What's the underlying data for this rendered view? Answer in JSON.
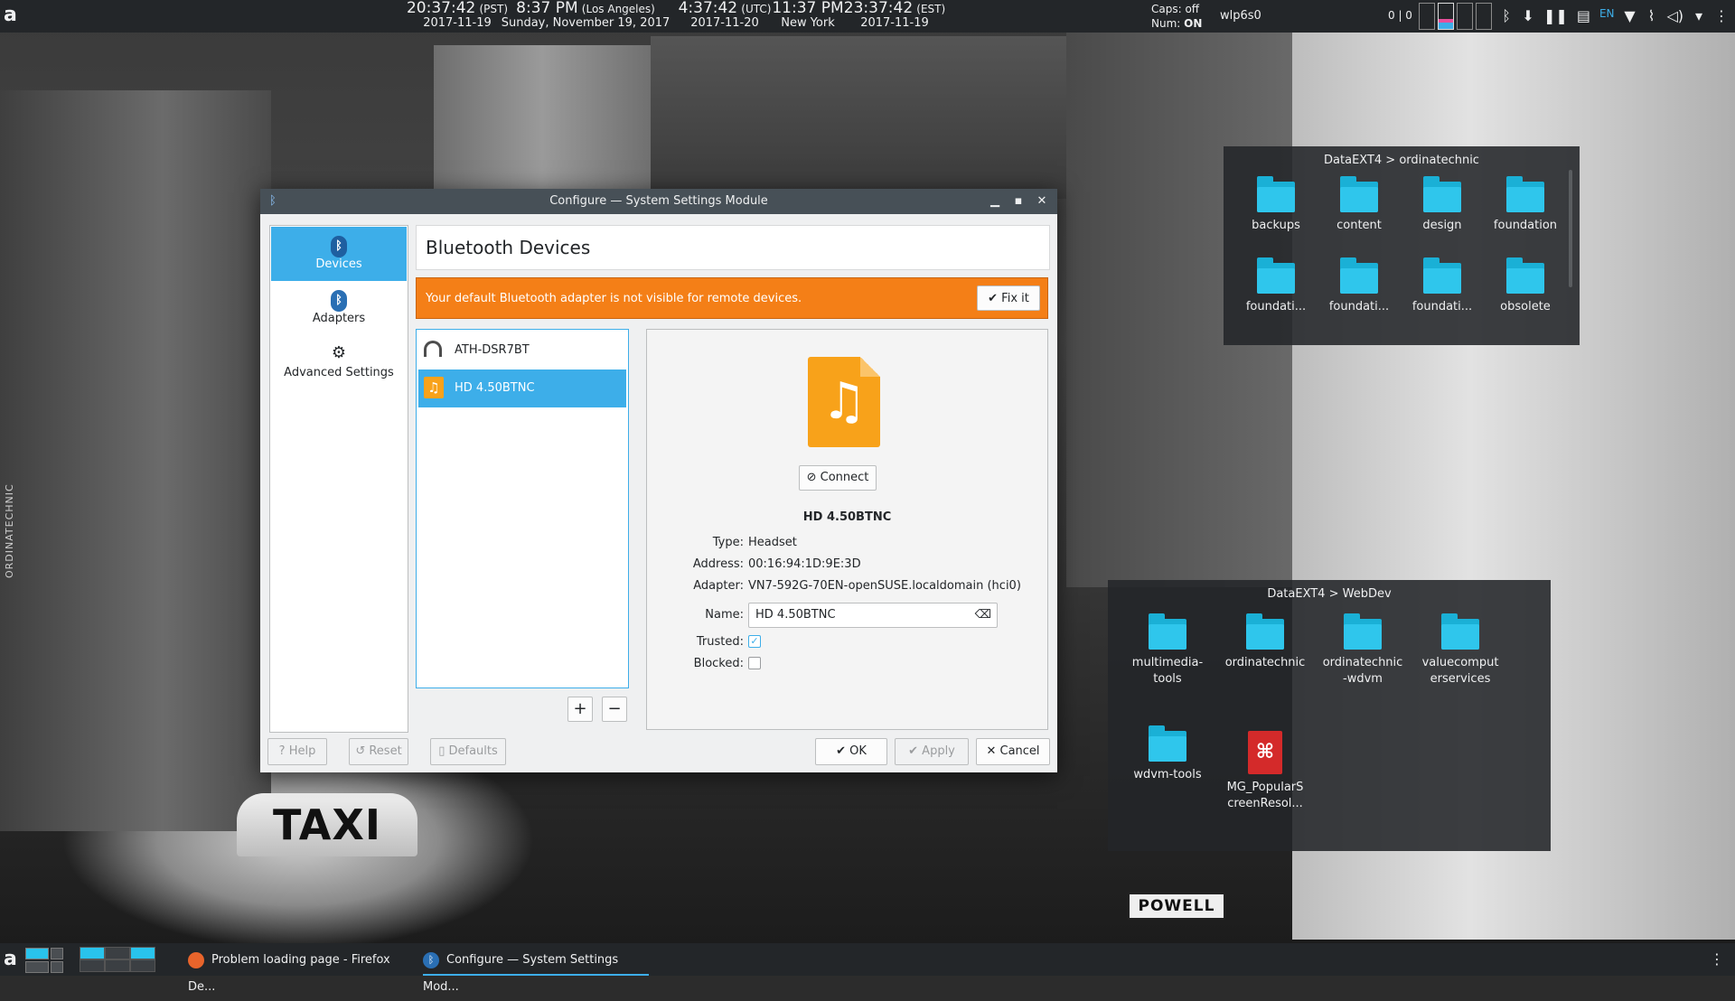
{
  "top_panel": {
    "clocks": [
      {
        "time": "20:37:42",
        "zone": "(PST)",
        "date": "2017-11-19"
      },
      {
        "time": "8:37 PM",
        "zone": "(Los Angeles)",
        "date": "Sunday, November 19, 2017"
      },
      {
        "time": "4:37:42",
        "zone": "(UTC)",
        "date": "2017-11-20"
      },
      {
        "time": "11:37 PM",
        "zone": "",
        "date": "New York"
      },
      {
        "time": "23:37:42",
        "zone": "(EST)",
        "date": "2017-11-19"
      }
    ],
    "caps": "Caps: off",
    "num_label": "Num:",
    "num_value": "ON",
    "network": "wlp6s0",
    "pager": "0 | 0",
    "lang": "EN"
  },
  "folderview_1": {
    "title": "DataEXT4 > ordinatechnic",
    "items": [
      "backups",
      "content",
      "design",
      "foundation",
      "foundati...",
      "foundati...",
      "foundati...",
      "obsolete"
    ]
  },
  "folderview_2": {
    "title": "DataEXT4 > WebDev",
    "items": [
      {
        "name": "multimedia-\ntools",
        "type": "folder"
      },
      {
        "name": "ordinatechnic",
        "type": "folder"
      },
      {
        "name": "ordinatechnic\n-wdvm",
        "type": "folder"
      },
      {
        "name": "valuecomput\nerservices",
        "type": "folder"
      },
      {
        "name": "wdvm-tools",
        "type": "folder"
      },
      {
        "name": "MG_PopularS\ncreenResol...",
        "type": "pdf"
      }
    ]
  },
  "dialog": {
    "title": "Configure — System Settings Module",
    "sidebar": [
      {
        "label": "Devices",
        "icon": "bluetooth-icon",
        "active": true
      },
      {
        "label": "Adapters",
        "icon": "bluetooth-icon",
        "active": false
      },
      {
        "label": "Advanced Settings",
        "icon": "gear-icon",
        "active": false
      }
    ],
    "header": "Bluetooth Devices",
    "warning": "Your default Bluetooth adapter is not visible for remote devices.",
    "fix_label": "Fix it",
    "devices": [
      {
        "name": "ATH-DSR7BT",
        "icon": "headphones-icon",
        "selected": false
      },
      {
        "name": "HD 4.50BTNC",
        "icon": "music-note-icon",
        "selected": true
      }
    ],
    "add_label": "+",
    "remove_label": "−",
    "details": {
      "connect_label": "Connect",
      "device_name": "HD 4.50BTNC",
      "type_label": "Type:",
      "type_value": "Headset",
      "address_label": "Address:",
      "address_value": "00:16:94:1D:9E:3D",
      "adapter_label": "Adapter:",
      "adapter_value": "VN7-592G-70EN-openSUSE.localdomain (hci0)",
      "name_label": "Name:",
      "name_value": "HD 4.50BTNC",
      "trusted_label": "Trusted:",
      "trusted": true,
      "blocked_label": "Blocked:",
      "blocked": false
    },
    "buttons": {
      "help": "Help",
      "reset": "Reset",
      "defaults": "Defaults",
      "ok": "OK",
      "apply": "Apply",
      "cancel": "Cancel"
    }
  },
  "wallpaper": {
    "taxi": "TAXI",
    "street": "POWELL",
    "side_label": "ORDINATECHNIC"
  },
  "bottom_panel": {
    "tasks": [
      {
        "label": "Problem loading page - Firefox De...",
        "icon": "firefox-icon",
        "active": false
      },
      {
        "label": "Configure — System Settings Mod...",
        "icon": "bluetooth-icon",
        "active": true
      }
    ]
  },
  "colors": {
    "accent": "#3daee9",
    "warning": "#f47f17",
    "folder": "#2fc6ec",
    "panel": "#232629"
  }
}
